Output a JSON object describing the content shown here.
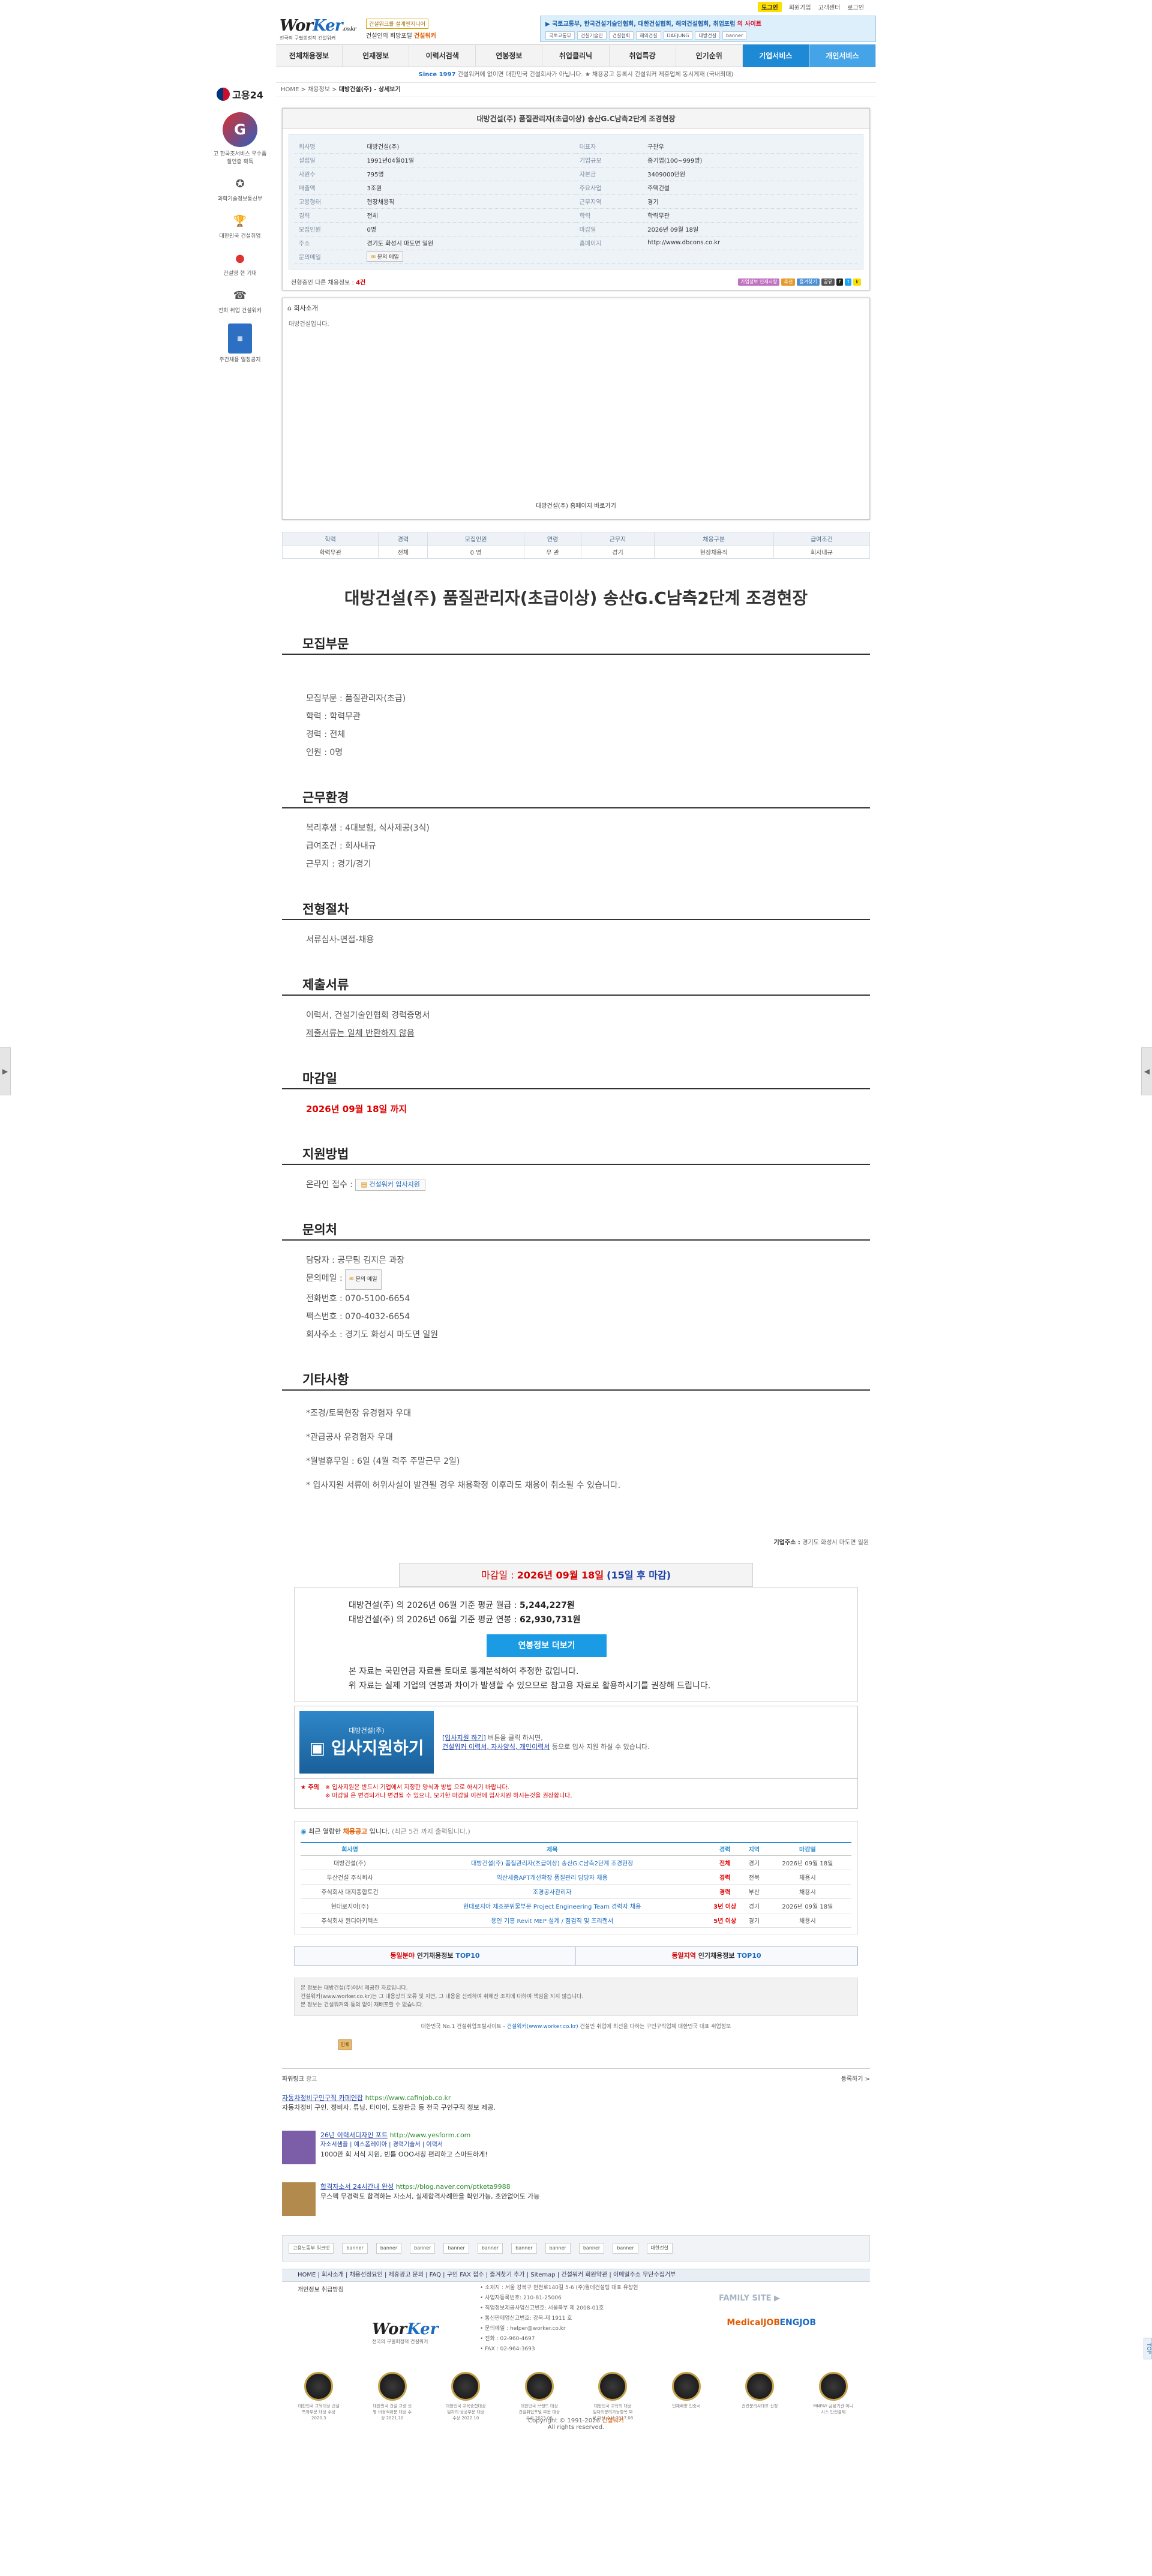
{
  "topbar": {
    "kakao": "도그인",
    "links": [
      "회원가입",
      "고객센터",
      "로그인"
    ]
  },
  "logo": {
    "wk_part1": "Wor",
    "wk_part2": "Ker",
    "suffix": ".co.kr",
    "tagline": "전국의 구필회정적 건설워커"
  },
  "header": {
    "badge": "건설워크를 설계엔지니어",
    "caption_a": "건설인의 희망포털",
    "caption_b": "건설워커",
    "news_a": "▶ 국토교통부, 한국건설기술인협회, 대한건설협회, 해외건설협회, 취업포럼",
    "news_b": "의 사이트",
    "banners": [
      "국토교통부",
      "건설기술인",
      "건설협회",
      "해외건설",
      "DAEJUNG",
      "대방건설",
      "banner"
    ]
  },
  "nav": [
    "전체채용정보",
    "인재정보",
    "이력서검색",
    "연봉정보",
    "취업클리닉",
    "취업특강",
    "인기순위",
    "기업서비스",
    "개인서비스"
  ],
  "notice": {
    "year": "Since 1997",
    "text": " 건설워커에 없이면 대한민국 건설회사가 아닙니다. ★ 채용공고 등록시 건설워커 제휴업체 동시게재 (국내최대)"
  },
  "breadcrumb": {
    "home": "HOME",
    "mid": "채용정보",
    "current": "대방건설(주) - 상세보기"
  },
  "quick_menu": {
    "goyong": "고용24",
    "items": [
      "고 한국조서비스 우수품질인증 획득",
      "과학기술정보통신부",
      "대한민국 건설취업",
      "건설영 현 기대",
      "전화 취업 건설워커",
      "주간채용 일정공지"
    ]
  },
  "company": {
    "title": "대방건설(주) 품질관리자(초급이상) 송산G.C남측2단계 조경현장",
    "rows": [
      [
        {
          "k": "회사명",
          "v": "대방건설(주)"
        },
        {
          "k": "대표자",
          "v": "구찬우"
        }
      ],
      [
        {
          "k": "설립일",
          "v": "1991년04월01일"
        },
        {
          "k": "기업규모",
          "v": "중기업(100~999명)"
        }
      ],
      [
        {
          "k": "사원수",
          "v": "795명"
        },
        {
          "k": "자본금",
          "v": "3409000만원"
        }
      ],
      [
        {
          "k": "매출액",
          "v": "3조원"
        },
        {
          "k": "주요사업",
          "v": "주택건설"
        }
      ],
      [
        {
          "k": "고용형태",
          "v": "현장채용직"
        },
        {
          "k": "근무지역",
          "v": "경기"
        }
      ],
      [
        {
          "k": "경력",
          "v": "전체"
        },
        {
          "k": "학력",
          "v": "학력무관"
        }
      ],
      [
        {
          "k": "모집인원",
          "v": "0명"
        },
        {
          "k": "마감일",
          "v": "2026년 09월 18일"
        }
      ],
      [
        {
          "k": "주소",
          "v": "경기도 화성시 마도면 일원"
        },
        {
          "k": "홈페이지",
          "v": "http://www.dbcons.co.kr"
        }
      ]
    ],
    "inquiry_label": "문의메일",
    "mail_button": "문의 메일",
    "foot_left": "전형중인 다른 채용정보 : ",
    "foot_count": "4건",
    "foot_icons": [
      "기업정보 인재사항",
      "추천",
      "즐겨찾기",
      "공유"
    ]
  },
  "intro": {
    "header": "회사소개",
    "body": "대방건설입니다.",
    "link": "대방건설(주) 홈페이지 바로가기"
  },
  "summary": {
    "headers": [
      "학력",
      "경력",
      "모집인원",
      "연령",
      "근무지",
      "채용구분",
      "급여조건"
    ],
    "values": [
      "학력무관",
      "전체",
      "0 명",
      "무 관",
      "경기",
      "현장채용직",
      "회사내규"
    ]
  },
  "job_title": "대방건설(주) 품질관리자(초급이상) 송산G.C남측2단계 조경현장",
  "sections": {
    "recruit": {
      "title": "모집부문",
      "lines": [
        "모집부문 : 품질관리자(초급)",
        "학력 : 학력무관",
        "경력 : 전체",
        "인원 : 0명"
      ]
    },
    "env": {
      "title": "근무환경",
      "lines": [
        "복리후생 : 4대보험, 식사제공(3식)",
        "급여조건 : 회사내규",
        "근무지 : 경기/경기"
      ]
    },
    "process": {
      "title": "전형절차",
      "lines": [
        "서류심사-면접-채용"
      ]
    },
    "docs": {
      "title": "제출서류",
      "line1": "이력서, 건설기술인협회 경력증명서",
      "line2": "제출서류는 일체 반환하지 않음"
    },
    "deadline": {
      "title": "마감일",
      "value": "2026년 09월 18일 까지"
    },
    "apply": {
      "title": "지원방법",
      "label": "온라인 접수 : ",
      "button": "건설워커 입사지원"
    },
    "contact": {
      "title": "문의처",
      "lines": [
        "담당자 : 공무팀 김지은 과장"
      ],
      "mail_label": "문의메일 : ",
      "mail_button": "문의 메일",
      "lines2": [
        "전화번호 : 070-5100-6654",
        "팩스번호 : 070-4032-6654",
        "회사주소 : 경기도 화성시 마도면 일원"
      ]
    },
    "etc": {
      "title": "기타사항",
      "lines": [
        "*조경/토목현장 유경험자 우대",
        "*관급공사 유경험자 우대",
        "*월별휴무일 : 6일 (4월 격주 주말근무 2일)",
        "* 입사지원 서류에 허위사실이 발견될 경우 채용확정 이후라도 채용이 취소될 수 있습니다."
      ]
    }
  },
  "address_right": {
    "label": "기업주소 : ",
    "value": "경기도 화성시 마도면 일원"
  },
  "deadline_bar": {
    "label": "마감일 : ",
    "date": "2026년 09월 18일",
    "left": "(15일 후 마감)"
  },
  "salary": {
    "line1_pre": "대방건설(주) 의 2026년 06월 기준 평균 월급 : ",
    "line1_val": "5,244,227원",
    "line2_pre": "대방건설(주) 의 2026년 06월 기준 평균 연봉 : ",
    "line2_val": "62,930,731원",
    "button": "연봉정보 더보기",
    "note1": "본 자료는 국민연금 자료를 토대로 통계분석하여 추정한 값입니다.",
    "note2": "위 자료는 실제 기업의 연봉과 차이가 발생할 수 있으므로 참고용 자료로 활용하시기를 권장해 드립니다."
  },
  "apply_box": {
    "company": "대방건설(주)",
    "big": "입사지원하기",
    "t1_link": "[입사지원 하기]",
    "t1": " 버튼을 클릭 하시면,",
    "t2_link": "건설워커 이력서, 자사양식, 개인이력서",
    "t2": " 등으로 입사 지원 하실 수 있습니다.",
    "caution_label": "주의",
    "caution1": "※ 입사지원은 반드시 기업에서 지정한 양식과 방법 으로 하시기 바랍니다.",
    "caution2": "※ 마감일 은 변경되거나 변경될 수 있으니, 모기한 마감일 이전에 입사지원 하시는것을 권장합니다."
  },
  "list": {
    "head_a": "최근 열람한 ",
    "head_b": "채용공고",
    "head_c": " 입니다.",
    "head_d": "(최근 5건 까지 출력됩니다.)",
    "headers": [
      "회사명",
      "제목",
      "경력",
      "지역",
      "마감일"
    ],
    "rows": [
      [
        "대방건설(주)",
        "대방건설(주) 품질관리자(초급이상) 송산G.C남측2단계 조경현장",
        "전체",
        "경기",
        "2026년 09월 18일"
      ],
      [
        "두산건설 주식회사",
        "익산세종APT개선확장 품질관리 담당자 채용",
        "경력",
        "전북",
        "채용시"
      ],
      [
        "주식회사 대지종합토건",
        "조경공사관리자",
        "경력",
        "부산",
        "채용시"
      ],
      [
        "현대로지아(주)",
        "현대로지아 제조분위물부문 Project Engineering Team 경력자 채용",
        "3년 이상",
        "경기",
        "2026년 09월 18일"
      ],
      [
        "주식회사 윈디아키텍츠",
        "용인 기흥 Revit MEP 설계 / 점검직 및 프리랜서",
        "5년 이상",
        "경기",
        "채용시"
      ]
    ]
  },
  "tops": [
    {
      "a": "동일분야",
      "b": " 인기채용정보 ",
      "c": "TOP10"
    },
    {
      "a": "동일지역",
      "b": " 인기채용정보 ",
      "c": "TOP10"
    }
  ],
  "disclaimer": {
    "l1": "본 정보는 대방건설(주)에서 제공한 자료입니다.",
    "l2": "건설워커(www.worker.co.kr)는 그 내용상의 오류 및 지연, 그 내용을 신뢰하여 취해진 조치에 대하여 책임을 지지 않습니다.",
    "l3": "본 정보는 건설워커의 동의 없이 재배포할 수 없습니다."
  },
  "copyline": {
    "a": "대한민국 No.1 건설취업포털사이트 - ",
    "b": "건설워커(www.worker.co.kr)",
    "c": " 건설인 취업에 최선을 다하는 구인구직업체 대한민국 대표 취업정보"
  },
  "print": "인쇄",
  "ads": {
    "label": "파워링크 ",
    "pw": "광고",
    "register": "등록하기 >",
    "items": [
      {
        "title": "자동차정비구인구직 카페인잡",
        "url": "https://www.cafinjob.co.kr",
        "desc": "자동차정비 구인, 정비사, 튜닝, 타이어, 도장판금 등 전국 구인구직 정보 제공."
      },
      {
        "title": "26년 이력서디자인 포트",
        "url": "http://www.yesform.com",
        "sub": "자소서샘플 | 예스폼레이아 | 경력기술서 | 이력서",
        "desc": "1000만 회 서식 지원, 빈틈 OOO서칭 편리하고 스마트하게!"
      },
      {
        "title": "합격자소서 24시간내 완성",
        "url": "https://blog.naver.com/ptketa9988",
        "desc": "무스펙 무경력도 합격하는 자소서, 실제합격사례만을 확인가능, 초안없어도 가능"
      }
    ]
  },
  "partners": [
    "고용노동부 워크넷",
    "banner",
    "banner",
    "banner",
    "banner",
    "banner",
    "banner",
    "banner",
    "banner",
    "banner",
    "대한건설"
  ],
  "fnav": "HOME | 회사소개 | 채용선정요인 | 제휴광고 문의 | FAQ | 구인 FAX 접수 | 즐겨찾기 추가 | Sitemap | 건설워커 회원약관 | 이메일주소 무단수집거부",
  "footer": {
    "privacy": "개인정보 취급방침",
    "info": [
      "• 소재지 : 서울 강북구 한천로140길 5-6 (주)월데건설팅 대표 유창현",
      "• 사업자등록번호: 210-81-25006",
      "• 직업정보제공사업신고번호: 서울북부 제 2008-01호",
      "• 통신판매업신고번호: 강북-제 1911 호",
      "• 문의메일 : helper@worker.co.kr",
      "• 전화 : 02-960-4697",
      "• FAX : 02-964-3693"
    ],
    "family": "FAMILY SITE ▶",
    "fam1": "MedicalJOB",
    "fam2": "ENGJOB",
    "badges": [
      "대한민국 교육대상 건설특화부문 대상 수상 2020.3",
      "대한민국 건설·교량 신평 비정적확분 대상 수상 2021.10",
      "대한민국 교육종합대상 일자리·공공부문 대상 수상 2022.10",
      "대한민국 브랜드 대상 건설취업포털 부문 대상 수상 2023.06",
      "대한민국 교육의 대상 일자리분리가능항목 부문 대상 수상 2017.08",
      "인재배양 인증서",
      "관련분리사대표 신청",
      "MNPAY 금융기관 이니시스 안전결제"
    ],
    "copyright_a": "Copyright © 1991-2026 ",
    "copyright_b": "건설워커",
    "copyright_c": "All rights reserved."
  }
}
